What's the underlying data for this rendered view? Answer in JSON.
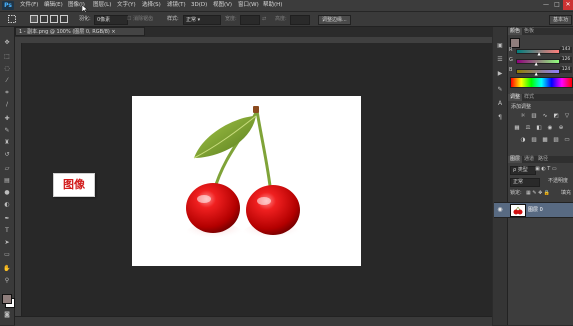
{
  "app": {
    "logo": "Ps"
  },
  "menu": [
    "文件(F)",
    "编辑(E)",
    "图像(I)",
    "图层(L)",
    "文字(Y)",
    "选择(S)",
    "滤镜(T)",
    "3D(D)",
    "视图(V)",
    "窗口(W)",
    "帮助(H)"
  ],
  "window_controls": {
    "minimize": "—",
    "maximize": "□",
    "close": "✕"
  },
  "options": {
    "feather_label": "羽化:",
    "feather_value": "0像素",
    "antialias_label": "消除锯齿",
    "style_label": "样式:",
    "style_value": "正常",
    "width_label": "宽度:",
    "height_label": "高度:",
    "refine_button": "调整边缘...",
    "workspace_button": "基本功"
  },
  "document": {
    "tab_title": "1 - 副本.png @ 100% (图层 0, RGB/8)",
    "close": "×"
  },
  "callout": {
    "text": "图像"
  },
  "color_panel": {
    "tabs": [
      "颜色",
      "色板"
    ],
    "channels": [
      {
        "label": "R",
        "value": "143",
        "fraction": 0.56
      },
      {
        "label": "G",
        "value": "126",
        "fraction": 0.49
      },
      {
        "label": "B",
        "value": "124",
        "fraction": 0.49
      }
    ]
  },
  "adjust_panel": {
    "tabs": [
      "调整",
      "样式"
    ],
    "title": "添加调整"
  },
  "layers_panel": {
    "tabs": [
      "图层",
      "通道",
      "路径"
    ],
    "filter_label": "ρ 类型",
    "blend_mode": "正常",
    "opacity_label": "不透明度",
    "lock_label": "锁定:",
    "fill_label": "填充",
    "layer_name": "图层 0"
  },
  "colors": {
    "foreground": "#8f7e7c",
    "background": "#ffffff",
    "layer_selected": "#586a82",
    "callout_text": "#d21b1b"
  }
}
